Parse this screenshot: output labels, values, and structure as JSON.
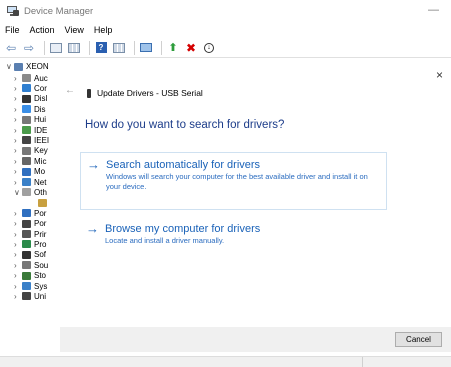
{
  "window": {
    "title": "Device Manager",
    "minimize_glyph": "—"
  },
  "menu": [
    "File",
    "Action",
    "View",
    "Help"
  ],
  "toolbar": {
    "icons": [
      "back-arrow-icon",
      "forward-arrow-icon",
      "properties-icon",
      "update-driver-grid-icon",
      "help-icon",
      "view-grid-icon",
      "monitor-icon",
      "enable-device-icon",
      "uninstall-x-icon",
      "download-icon"
    ]
  },
  "tree": {
    "root": "XEON",
    "items": [
      {
        "label": "Auc",
        "color": "#8a8a8a",
        "expanded": false
      },
      {
        "label": "Cor",
        "color": "#2f7fd0",
        "expanded": false
      },
      {
        "label": "Disl",
        "color": "#333333",
        "expanded": false
      },
      {
        "label": "Dis",
        "color": "#3a8ee6",
        "expanded": false
      },
      {
        "label": "Hui",
        "color": "#777777",
        "expanded": false
      },
      {
        "label": "IDE",
        "color": "#4a9a4a",
        "expanded": false
      },
      {
        "label": "IEEI",
        "color": "#444444",
        "expanded": false
      },
      {
        "label": "Key",
        "color": "#777777",
        "expanded": false
      },
      {
        "label": "Mic",
        "color": "#666666",
        "expanded": false
      },
      {
        "label": "Mo",
        "color": "#2f6fc0",
        "expanded": false
      },
      {
        "label": "Net",
        "color": "#3a80c8",
        "expanded": false
      },
      {
        "label": "Oth",
        "color": "#a0a0a0",
        "expanded": true
      },
      {
        "label": "",
        "color": "#c8a040",
        "expanded": null
      },
      {
        "label": "Por",
        "color": "#2f6fc0",
        "expanded": false
      },
      {
        "label": "Por",
        "color": "#444444",
        "expanded": false
      },
      {
        "label": "Prir",
        "color": "#555555",
        "expanded": false
      },
      {
        "label": "Pro",
        "color": "#2a8a4a",
        "expanded": false
      },
      {
        "label": "Sof",
        "color": "#333333",
        "expanded": false
      },
      {
        "label": "Sou",
        "color": "#777777",
        "expanded": false
      },
      {
        "label": "Sto",
        "color": "#3a7a3a",
        "expanded": false
      },
      {
        "label": "Sys",
        "color": "#3a80c8",
        "expanded": false
      },
      {
        "label": "Uni",
        "color": "#444444",
        "expanded": false
      }
    ]
  },
  "dialog": {
    "close_glyph": "×",
    "back_glyph": "←",
    "header": "Update Drivers - USB Serial",
    "question": "How do you want to search for drivers?",
    "option1": {
      "title": "Search automatically for drivers",
      "description": "Windows will search your computer for the best available driver and install it on your device."
    },
    "option2": {
      "title": "Browse my computer for drivers",
      "description": "Locate and install a driver manually."
    },
    "cancel_label": "Cancel",
    "arrow_glyph": "→"
  }
}
